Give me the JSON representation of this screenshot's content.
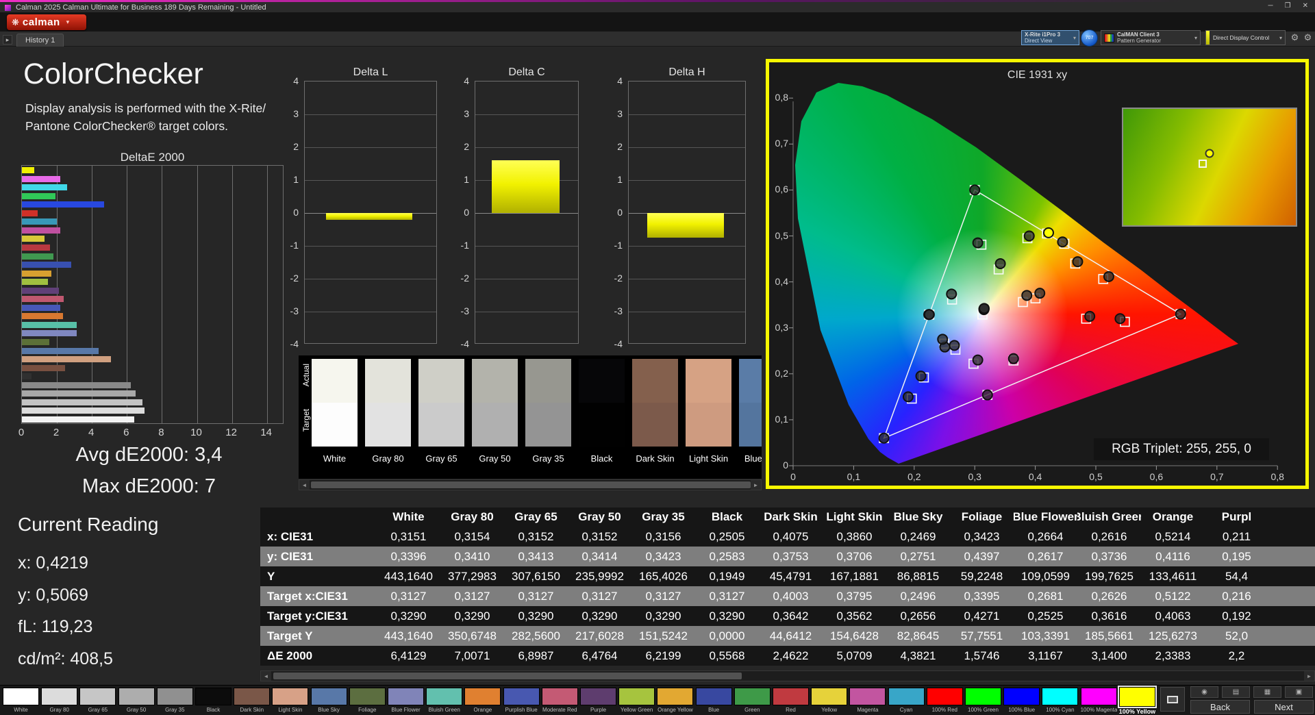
{
  "window": {
    "title": "Calman 2025 Calman Ultimate for Business 189 Days Remaining - Untitled"
  },
  "icons": {
    "logo_mark": "❋",
    "dropdown": "▾",
    "minimize": "─",
    "maximize": "❐",
    "close": "✕",
    "tab_nav": "▸",
    "gear": "⚙",
    "scroll_left": "◄",
    "scroll_right": "►",
    "nav_icon_1": "◉",
    "nav_icon_2": "▤",
    "nav_icon_3": "▦",
    "nav_icon_4": "▣"
  },
  "toolbar": {
    "logo_text": "calman",
    "meter_line1": "X-Rite i1Pro 3",
    "meter_line2": "Direct View",
    "meter_badge": "707",
    "pattern_line1": "CalMAN Client 3",
    "pattern_line2": "Pattern Generator",
    "display_control": "Direct Display Control"
  },
  "tabs": {
    "history1": "History 1"
  },
  "colorchecker": {
    "title": "ColorChecker",
    "subtitle1": "Display analysis is performed with the X-Rite/",
    "subtitle2": "Pantone ColorChecker® target colors.",
    "avg": "Avg dE2000: 3,4",
    "max": "Max dE2000: 7"
  },
  "current_reading": {
    "title": "Current Reading",
    "x": "x: 0,4219",
    "y": "y: 0,5069",
    "fl": "fL: 119,23",
    "cd": "cd/m²: 408,5"
  },
  "chart_data": [
    {
      "type": "bar",
      "orientation": "horizontal",
      "title": "DeltaE 2000",
      "xlim": [
        0,
        14
      ],
      "xticks": [
        0,
        2,
        4,
        6,
        8,
        10,
        12,
        14
      ],
      "bars": [
        {
          "label": "100% Yellow",
          "value": 0.7,
          "color": "#f0f000"
        },
        {
          "label": "100% Magenta",
          "value": 2.2,
          "color": "#e86ae8"
        },
        {
          "label": "100% Cyan",
          "value": 2.6,
          "color": "#40d8e8"
        },
        {
          "label": "100% Green",
          "value": 1.9,
          "color": "#30c858"
        },
        {
          "label": "100% Blue",
          "value": 4.7,
          "color": "#2848e0"
        },
        {
          "label": "100% Red",
          "value": 0.9,
          "color": "#d03028"
        },
        {
          "label": "Cyan",
          "value": 2.0,
          "color": "#3898b8"
        },
        {
          "label": "Magenta",
          "value": 2.2,
          "color": "#c050a0"
        },
        {
          "label": "Yellow",
          "value": 1.3,
          "color": "#d8c838"
        },
        {
          "label": "Red",
          "value": 1.6,
          "color": "#b83840"
        },
        {
          "label": "Green",
          "value": 1.8,
          "color": "#409850"
        },
        {
          "label": "Blue",
          "value": 2.8,
          "color": "#3850b0"
        },
        {
          "label": "Orange Yellow",
          "value": 1.7,
          "color": "#d8a030"
        },
        {
          "label": "Yellow Green",
          "value": 1.5,
          "color": "#a0c040"
        },
        {
          "label": "Purple",
          "value": 2.1,
          "color": "#604078"
        },
        {
          "label": "Moderate Red",
          "value": 2.4,
          "color": "#c05870"
        },
        {
          "label": "Purplish Blue",
          "value": 2.2,
          "color": "#4858b8"
        },
        {
          "label": "Orange",
          "value": 2.34,
          "color": "#d87830"
        },
        {
          "label": "Bluish Green",
          "value": 3.14,
          "color": "#58c0a8"
        },
        {
          "label": "Blue Flower",
          "value": 3.12,
          "color": "#8088c0"
        },
        {
          "label": "Foliage",
          "value": 1.57,
          "color": "#5c7038"
        },
        {
          "label": "Blue Sky",
          "value": 4.38,
          "color": "#5878a8"
        },
        {
          "label": "Light Skin",
          "value": 5.07,
          "color": "#d0a080"
        },
        {
          "label": "Dark Skin",
          "value": 2.46,
          "color": "#785040"
        },
        {
          "label": "Black",
          "value": 0.56,
          "color": "#303030"
        },
        {
          "label": "Gray 35",
          "value": 6.22,
          "color": "#8a8a8a"
        },
        {
          "label": "Gray 50",
          "value": 6.48,
          "color": "#a8a8a8"
        },
        {
          "label": "Gray 65",
          "value": 6.9,
          "color": "#c4c4c4"
        },
        {
          "label": "Gray 80",
          "value": 7.01,
          "color": "#dcdcdc"
        },
        {
          "label": "White",
          "value": 6.41,
          "color": "#f2f2f2"
        }
      ]
    },
    {
      "type": "bar",
      "title": "Delta L",
      "ylim": [
        -4,
        4
      ],
      "yticks": [
        "4",
        "3",
        "2",
        "1",
        "0",
        "-1",
        "-2",
        "-3",
        "-4"
      ],
      "value": -0.2
    },
    {
      "type": "bar",
      "title": "Delta C",
      "ylim": [
        -4,
        4
      ],
      "yticks": [
        "4",
        "3",
        "2",
        "1",
        "0",
        "-1",
        "-2",
        "-3",
        "-4"
      ],
      "value": 1.6
    },
    {
      "type": "bar",
      "title": "Delta H",
      "ylim": [
        -4,
        4
      ],
      "yticks": [
        "4",
        "3",
        "2",
        "1",
        "0",
        "-1",
        "-2",
        "-3",
        "-4"
      ],
      "value": -0.75
    },
    {
      "type": "scatter",
      "title": "CIE 1931 xy",
      "xlim": [
        0,
        0.8
      ],
      "ylim": [
        0,
        0.8
      ],
      "xticks": [
        "0",
        "0,1",
        "0,2",
        "0,3",
        "0,4",
        "0,5",
        "0,6",
        "0,7",
        "0,8"
      ],
      "yticks": [
        "0",
        "0,1",
        "0,2",
        "0,3",
        "0,4",
        "0,5",
        "0,6",
        "0,7",
        "0,8"
      ],
      "annotation": "RGB Triplet: 255, 255, 0",
      "gamut_triangle": [
        [
          0.64,
          0.33
        ],
        [
          0.3,
          0.6
        ],
        [
          0.15,
          0.06
        ]
      ],
      "points": [
        {
          "name": "White",
          "a": [
            0.3151,
            0.3396
          ],
          "t": [
            0.3127,
            0.329
          ]
        },
        {
          "name": "Gray 80",
          "a": [
            0.3154,
            0.341
          ],
          "t": [
            0.3127,
            0.329
          ]
        },
        {
          "name": "Gray 65",
          "a": [
            0.3152,
            0.3413
          ],
          "t": [
            0.3127,
            0.329
          ]
        },
        {
          "name": "Gray 50",
          "a": [
            0.3152,
            0.3414
          ],
          "t": [
            0.3127,
            0.329
          ]
        },
        {
          "name": "Gray 35",
          "a": [
            0.3156,
            0.3423
          ],
          "t": [
            0.3127,
            0.329
          ]
        },
        {
          "name": "Black",
          "a": [
            0.2505,
            0.2583
          ],
          "t": [
            0.3127,
            0.329
          ]
        },
        {
          "name": "Dark Skin",
          "a": [
            0.4075,
            0.3753
          ],
          "t": [
            0.4003,
            0.3642
          ]
        },
        {
          "name": "Light Skin",
          "a": [
            0.386,
            0.3706
          ],
          "t": [
            0.3795,
            0.3562
          ]
        },
        {
          "name": "Blue Sky",
          "a": [
            0.2469,
            0.2751
          ],
          "t": [
            0.2496,
            0.2656
          ]
        },
        {
          "name": "Foliage",
          "a": [
            0.3423,
            0.4397
          ],
          "t": [
            0.3395,
            0.4271
          ]
        },
        {
          "name": "Blue Flower",
          "a": [
            0.2664,
            0.2617
          ],
          "t": [
            0.2681,
            0.2525
          ]
        },
        {
          "name": "Bluish Green",
          "a": [
            0.2616,
            0.3736
          ],
          "t": [
            0.2626,
            0.3616
          ]
        },
        {
          "name": "Orange",
          "a": [
            0.5214,
            0.4116
          ],
          "t": [
            0.5122,
            0.4063
          ]
        },
        {
          "name": "Purplish Blue",
          "a": [
            0.211,
            0.195
          ],
          "t": [
            0.216,
            0.192
          ]
        },
        {
          "name": "Moderate Red",
          "a": [
            0.49,
            0.325
          ],
          "t": [
            0.484,
            0.32
          ]
        },
        {
          "name": "Purple",
          "a": [
            0.305,
            0.23
          ],
          "t": [
            0.298,
            0.222
          ]
        },
        {
          "name": "Yellow Green",
          "a": [
            0.39,
            0.5
          ],
          "t": [
            0.387,
            0.495
          ]
        },
        {
          "name": "Orange Yellow",
          "a": [
            0.47,
            0.444
          ],
          "t": [
            0.466,
            0.44
          ]
        },
        {
          "name": "Blue",
          "a": [
            0.19,
            0.15
          ],
          "t": [
            0.196,
            0.146
          ]
        },
        {
          "name": "Green",
          "a": [
            0.305,
            0.485
          ],
          "t": [
            0.311,
            0.481
          ]
        },
        {
          "name": "Red",
          "a": [
            0.54,
            0.32
          ],
          "t": [
            0.548,
            0.313
          ]
        },
        {
          "name": "Yellow",
          "a": [
            0.445,
            0.487
          ],
          "t": [
            0.448,
            0.483
          ]
        },
        {
          "name": "Magenta",
          "a": [
            0.364,
            0.233
          ],
          "t": [
            0.364,
            0.229
          ]
        },
        {
          "name": "Cyan",
          "a": [
            0.224,
            0.329
          ],
          "t": [
            0.225,
            0.329
          ]
        },
        {
          "name": "100% Red",
          "a": [
            0.64,
            0.33
          ],
          "t": [
            0.64,
            0.33
          ]
        },
        {
          "name": "100% Green",
          "a": [
            0.3,
            0.6
          ],
          "t": [
            0.3,
            0.6
          ]
        },
        {
          "name": "100% Blue",
          "a": [
            0.15,
            0.06
          ],
          "t": [
            0.15,
            0.06
          ]
        },
        {
          "name": "100% Cyan",
          "a": [
            0.225,
            0.329
          ],
          "t": [
            0.2246,
            0.3287
          ]
        },
        {
          "name": "100% Magenta",
          "a": [
            0.321,
            0.154
          ],
          "t": [
            0.321,
            0.154
          ]
        },
        {
          "name": "100% Yellow",
          "a": [
            0.4219,
            0.5069
          ],
          "t": [
            0.4193,
            0.5053
          ],
          "highlight": true
        }
      ]
    }
  ],
  "swatch_strip": {
    "actual_label": "Actual",
    "target_label": "Target",
    "swatches": [
      {
        "name": "White",
        "actual": "#f6f6ee",
        "target": "#fdfdfd"
      },
      {
        "name": "Gray 80",
        "actual": "#e3e3db",
        "target": "#e2e2e2"
      },
      {
        "name": "Gray 65",
        "actual": "#cfcfc7",
        "target": "#cbcbcb"
      },
      {
        "name": "Gray 50",
        "actual": "#b3b3ab",
        "target": "#b0b0b0"
      },
      {
        "name": "Gray 35",
        "actual": "#979790",
        "target": "#949494"
      },
      {
        "name": "Black",
        "actual": "#060608",
        "target": "#010101"
      },
      {
        "name": "Dark Skin",
        "actual": "#84604d",
        "target": "#7c5a4b"
      },
      {
        "name": "Light Skin",
        "actual": "#d6a284",
        "target": "#ce9b80"
      },
      {
        "name": "Blue Sky",
        "actual": "#5a7ca7",
        "target": "#54759e"
      }
    ]
  },
  "table": {
    "columns": [
      "White",
      "Gray 80",
      "Gray 65",
      "Gray 50",
      "Gray 35",
      "Black",
      "Dark Skin",
      "Light Skin",
      "Blue Sky",
      "Foliage",
      "Blue Flower",
      "Bluish Green",
      "Orange",
      "Purpl"
    ],
    "rows": [
      {
        "label": "x: CIE31",
        "values": [
          "0,3151",
          "0,3154",
          "0,3152",
          "0,3152",
          "0,3156",
          "0,2505",
          "0,4075",
          "0,3860",
          "0,2469",
          "0,3423",
          "0,2664",
          "0,2616",
          "0,5214",
          "0,211"
        ]
      },
      {
        "label": "y: CIE31",
        "values": [
          "0,3396",
          "0,3410",
          "0,3413",
          "0,3414",
          "0,3423",
          "0,2583",
          "0,3753",
          "0,3706",
          "0,2751",
          "0,4397",
          "0,2617",
          "0,3736",
          "0,4116",
          "0,195"
        ]
      },
      {
        "label": "Y",
        "values": [
          "443,1640",
          "377,2983",
          "307,6150",
          "235,9992",
          "165,4026",
          "0,1949",
          "45,4791",
          "167,1881",
          "86,8815",
          "59,2248",
          "109,0599",
          "199,7625",
          "133,4611",
          "54,4"
        ]
      },
      {
        "label": "Target x:CIE31",
        "values": [
          "0,3127",
          "0,3127",
          "0,3127",
          "0,3127",
          "0,3127",
          "0,3127",
          "0,4003",
          "0,3795",
          "0,2496",
          "0,3395",
          "0,2681",
          "0,2626",
          "0,5122",
          "0,216"
        ]
      },
      {
        "label": "Target y:CIE31",
        "values": [
          "0,3290",
          "0,3290",
          "0,3290",
          "0,3290",
          "0,3290",
          "0,3290",
          "0,3642",
          "0,3562",
          "0,2656",
          "0,4271",
          "0,2525",
          "0,3616",
          "0,4063",
          "0,192"
        ]
      },
      {
        "label": "Target Y",
        "values": [
          "443,1640",
          "350,6748",
          "282,5600",
          "217,6028",
          "151,5242",
          "0,0000",
          "44,6412",
          "154,6428",
          "82,8645",
          "57,7551",
          "103,3391",
          "185,5661",
          "125,6273",
          "52,0"
        ]
      },
      {
        "label": "ΔE 2000",
        "values": [
          "6,4129",
          "7,0071",
          "6,8987",
          "6,4764",
          "6,2199",
          "0,5568",
          "2,4622",
          "5,0709",
          "4,3821",
          "1,5746",
          "3,1167",
          "3,1400",
          "2,3383",
          "2,2"
        ]
      }
    ]
  },
  "palette": {
    "items": [
      {
        "label": "White",
        "color": "#ffffff"
      },
      {
        "label": "Gray 80",
        "color": "#dcdcdc"
      },
      {
        "label": "Gray 65",
        "color": "#c6c6c6"
      },
      {
        "label": "Gray 50",
        "color": "#adadad"
      },
      {
        "label": "Gray 35",
        "color": "#909090"
      },
      {
        "label": "Black",
        "color": "#0c0c0c"
      },
      {
        "label": "Dark Skin",
        "color": "#7a5748"
      },
      {
        "label": "Light Skin",
        "color": "#d7a187"
      },
      {
        "label": "Blue Sky",
        "color": "#5878a8"
      },
      {
        "label": "Foliage",
        "color": "#5c6e40"
      },
      {
        "label": "Blue Flower",
        "color": "#8084b8"
      },
      {
        "label": "Bluish Green",
        "color": "#62c0ae"
      },
      {
        "label": "Orange",
        "color": "#e08030"
      },
      {
        "label": "Purplish Blue",
        "color": "#4858b0"
      },
      {
        "label": "Moderate Red",
        "color": "#c45a74"
      },
      {
        "label": "Purple",
        "color": "#5e3d6e"
      },
      {
        "label": "Yellow Green",
        "color": "#a6c43e"
      },
      {
        "label": "Orange Yellow",
        "color": "#e2a832"
      },
      {
        "label": "Blue",
        "color": "#3848a0"
      },
      {
        "label": "Green",
        "color": "#3e9a48"
      },
      {
        "label": "Red",
        "color": "#c03a40"
      },
      {
        "label": "Yellow",
        "color": "#e6d23a"
      },
      {
        "label": "Magenta",
        "color": "#c255a0"
      },
      {
        "label": "Cyan",
        "color": "#38a6c8"
      },
      {
        "label": "100% Red",
        "color": "#ff0000"
      },
      {
        "label": "100% Green",
        "color": "#00ff00"
      },
      {
        "label": "100% Blue",
        "color": "#0000ff"
      },
      {
        "label": "100% Cyan",
        "color": "#00ffff"
      },
      {
        "label": "100% Magenta",
        "color": "#ff00ff"
      },
      {
        "label": "100% Yellow",
        "color": "#ffff00",
        "selected": true
      }
    ]
  },
  "nav": {
    "back": "Back",
    "next": "Next"
  }
}
